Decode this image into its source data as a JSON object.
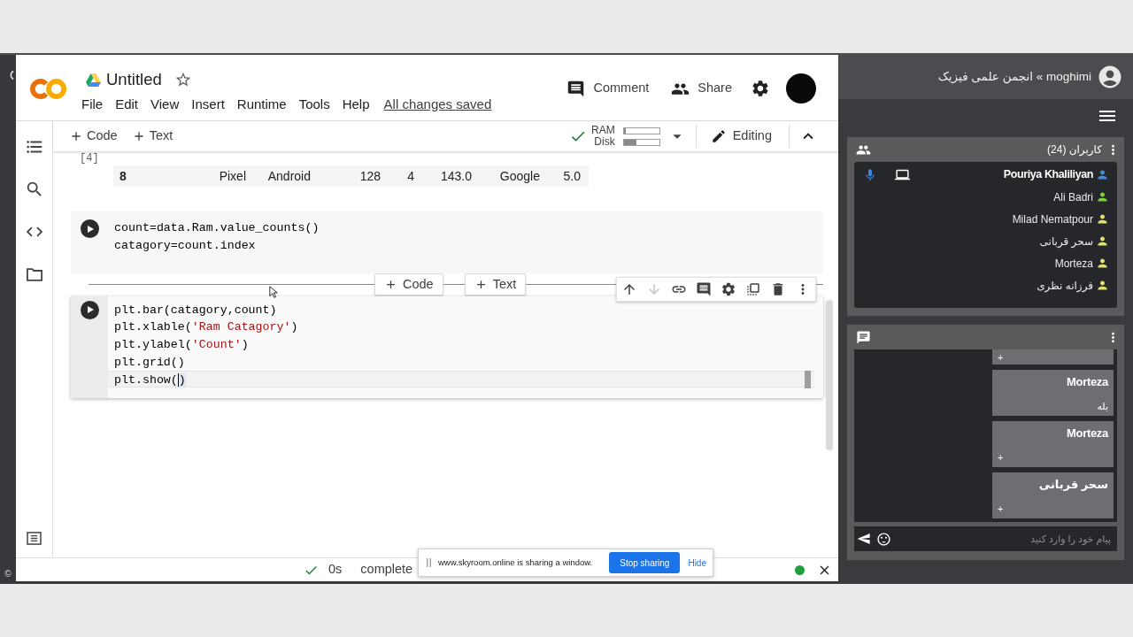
{
  "left_edge": {
    "symbol": "©"
  },
  "colab": {
    "title": "Untitled",
    "starred": false,
    "menu": [
      "File",
      "Edit",
      "View",
      "Insert",
      "Runtime",
      "Tools",
      "Help"
    ],
    "save_status": "All changes saved",
    "actions": [
      "Comment",
      "Share"
    ],
    "toolbar": {
      "add": [
        "Code",
        "Text"
      ],
      "connected": true,
      "meters": [
        {
          "label": "RAM",
          "level": 0.06
        },
        {
          "label": "Disk",
          "level": 0.35
        }
      ],
      "mode": "Editing"
    },
    "notebook": [
      {
        "kind": "output",
        "execution_count": "[4]",
        "index": "8",
        "cells": [
          "Pixel",
          "Android",
          "128",
          "4",
          "143.0",
          "Google",
          "5.0"
        ]
      },
      {
        "kind": "code",
        "selected": false,
        "lines": [
          {
            "active": false,
            "tokens": [
              {
                "kind": "plain",
                "text": "count=data.Ram.value_counts()"
              }
            ]
          },
          {
            "active": false,
            "tokens": [
              {
                "kind": "plain",
                "text": "catagory=count.index"
              }
            ]
          }
        ]
      },
      {
        "kind": "insert_bar",
        "buttons": [
          "Code",
          "Text"
        ]
      },
      {
        "kind": "code",
        "selected": true,
        "can_move_down": false,
        "lines": [
          {
            "active": false,
            "tokens": [
              {
                "kind": "plain",
                "text": "plt.bar(catagory,count)"
              }
            ]
          },
          {
            "active": false,
            "tokens": [
              {
                "kind": "plain",
                "text": "plt.xlable("
              },
              {
                "kind": "string",
                "text": "'Ram Catagory'"
              },
              {
                "kind": "plain",
                "text": ")"
              }
            ]
          },
          {
            "active": false,
            "tokens": [
              {
                "kind": "plain",
                "text": "plt.ylabel("
              },
              {
                "kind": "string",
                "text": "'Count'"
              },
              {
                "kind": "plain",
                "text": ")"
              }
            ]
          },
          {
            "active": false,
            "tokens": [
              {
                "kind": "plain",
                "text": "plt.grid()"
              }
            ]
          },
          {
            "active": true,
            "tokens": [
              {
                "kind": "plain",
                "text": "plt.show(",
                "cursor_before": false
              },
              {
                "kind": "plain",
                "text": ")",
                "cursor_before": true
              }
            ]
          }
        ]
      }
    ],
    "status": {
      "done": true,
      "duration": "0s",
      "text": "complete",
      "connected": true
    }
  },
  "share_notice": {
    "text": "www.skyroom.online is sharing a window.",
    "stop_button": "Stop sharing",
    "hide_link": "Hide"
  },
  "room": {
    "header": "moghimi » انجمن علمی فیزیک",
    "users": {
      "title": "کاربران (24)",
      "list": [
        {
          "name": "Pouriya Khaliliyan",
          "color": "#3f8fdc",
          "highlighted": true,
          "mic_on": true,
          "sharing_screen": true
        },
        {
          "name": "Ali Badri",
          "color": "#7fd13b",
          "highlighted": false,
          "mic_on": false,
          "sharing_screen": false
        },
        {
          "name": "Milad Nematpour",
          "color": "#e6df6a",
          "highlighted": false,
          "mic_on": false,
          "sharing_screen": false
        },
        {
          "name": "سحر قربانی",
          "color": "#e6df6a",
          "highlighted": false,
          "mic_on": false,
          "sharing_screen": false
        },
        {
          "name": "Morteza",
          "color": "#e6df6a",
          "highlighted": false,
          "mic_on": false,
          "sharing_screen": false
        },
        {
          "name": "فرزانه نظری",
          "color": "#e6df6a",
          "highlighted": false,
          "mic_on": false,
          "sharing_screen": false
        }
      ]
    },
    "chat": {
      "messages": [
        {
          "text": "+"
        },
        {
          "sender": "Morteza",
          "text": "بله"
        },
        {
          "sender": "Morteza",
          "text": "+"
        },
        {
          "sender": "سحر قربانی",
          "text": "+"
        }
      ],
      "placeholder": "پیام خود را وارد کنید"
    }
  }
}
